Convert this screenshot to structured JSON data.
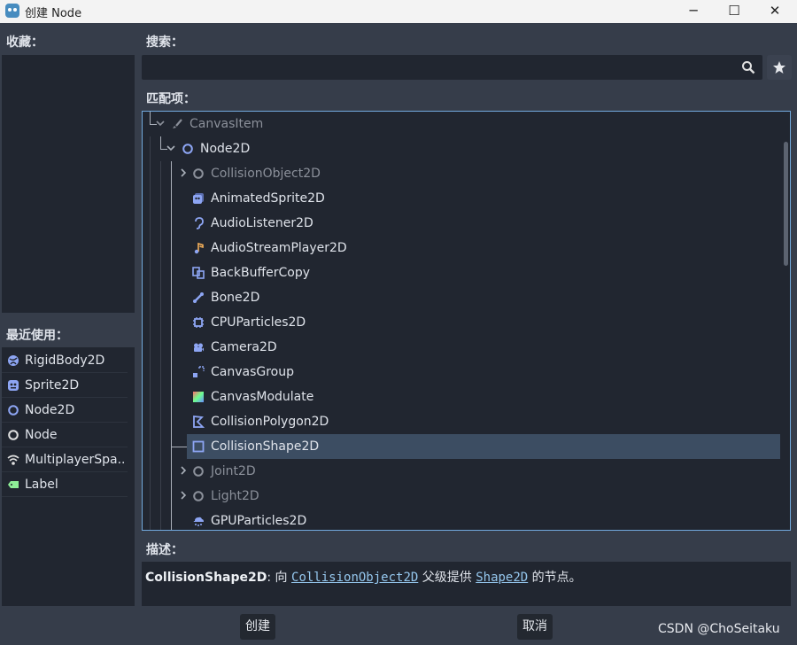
{
  "window": {
    "title": "创建 Node",
    "minimize": "─",
    "maximize": "☐",
    "close": "✕"
  },
  "favorites": {
    "label": "收藏："
  },
  "recent": {
    "label": "最近使用：",
    "items": [
      {
        "label": "RigidBody2D",
        "icon": "rigidbody-icon",
        "color": "#8da5f3"
      },
      {
        "label": "Sprite2D",
        "icon": "sprite-icon",
        "color": "#8da5f3"
      },
      {
        "label": "Node2D",
        "icon": "node2d-icon",
        "color": "#8da5f3"
      },
      {
        "label": "Node",
        "icon": "node-icon",
        "color": "#e0e0e0"
      },
      {
        "label": "MultiplayerSpa...",
        "icon": "multiplayer-icon",
        "color": "#e0e0e0"
      },
      {
        "label": "Label",
        "icon": "label-icon",
        "color": "#8eef97"
      }
    ]
  },
  "search": {
    "label": "搜索：",
    "placeholder": "",
    "value": ""
  },
  "matches": {
    "label": "匹配项：",
    "items": [
      {
        "label": "CanvasItem",
        "icon": "brush-icon",
        "disabled": true,
        "expanded": true,
        "depth": 0
      },
      {
        "label": "Node2D",
        "icon": "node2d-icon",
        "disabled": false,
        "expanded": true,
        "depth": 1
      },
      {
        "label": "CollisionObject2D",
        "icon": "circle-icon",
        "disabled": true,
        "collapsed": true,
        "depth": 2
      },
      {
        "label": "AnimatedSprite2D",
        "icon": "animated-sprite-icon",
        "disabled": false,
        "depth": 2
      },
      {
        "label": "AudioListener2D",
        "icon": "ear-icon",
        "disabled": false,
        "depth": 2
      },
      {
        "label": "AudioStreamPlayer2D",
        "icon": "music-note-icon",
        "disabled": false,
        "depth": 2
      },
      {
        "label": "BackBufferCopy",
        "icon": "backbuffer-icon",
        "disabled": false,
        "depth": 2
      },
      {
        "label": "Bone2D",
        "icon": "bone-icon",
        "disabled": false,
        "depth": 2
      },
      {
        "label": "CPUParticles2D",
        "icon": "cpu-particles-icon",
        "disabled": false,
        "depth": 2
      },
      {
        "label": "Camera2D",
        "icon": "camera-icon",
        "disabled": false,
        "depth": 2
      },
      {
        "label": "CanvasGroup",
        "icon": "canvas-group-icon",
        "disabled": false,
        "depth": 2
      },
      {
        "label": "CanvasModulate",
        "icon": "canvas-modulate-icon",
        "disabled": false,
        "depth": 2
      },
      {
        "label": "CollisionPolygon2D",
        "icon": "collision-polygon-icon",
        "disabled": false,
        "depth": 2
      },
      {
        "label": "CollisionShape2D",
        "icon": "collision-shape-icon",
        "disabled": false,
        "selected": true,
        "depth": 2
      },
      {
        "label": "Joint2D",
        "icon": "circle-icon",
        "disabled": true,
        "collapsed": true,
        "depth": 2
      },
      {
        "label": "Light2D",
        "icon": "circle-icon",
        "disabled": true,
        "collapsed": true,
        "depth": 2
      },
      {
        "label": "GPUParticles2D",
        "icon": "gpu-particles-icon",
        "disabled": false,
        "depth": 2
      }
    ]
  },
  "description": {
    "label": "描述：",
    "node": "CollisionShape2D",
    "sep": ": 向 ",
    "link1": "CollisionObject2D",
    "mid": " 父级提供 ",
    "link2": "Shape2D",
    "tail": " 的节点。"
  },
  "buttons": {
    "create": "创建",
    "cancel": "取消"
  },
  "watermark": "CSDN @ChoSeitaku",
  "colors": {
    "accent": "#72a9dd",
    "node2d": "#8da5f3",
    "selected_row": "#3c4d62"
  }
}
